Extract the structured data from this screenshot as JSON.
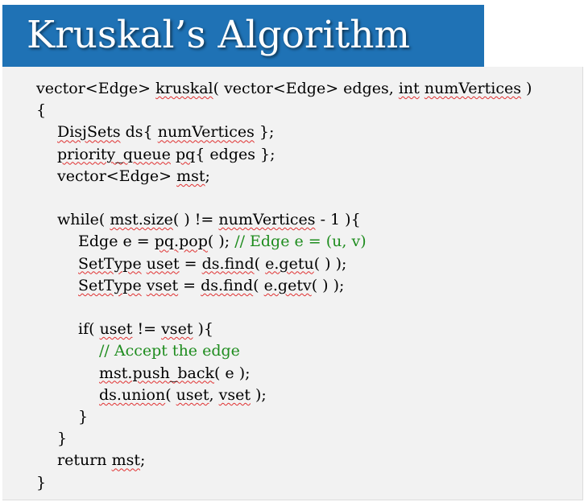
{
  "title": "Kruskal’s Algorithm",
  "colors": {
    "title_bg": "#1f72b5",
    "title_text": "#ffffff",
    "code_bg": "#f2f2f2",
    "comment": "#1e8c1e",
    "spellcheck_underline": "#e03030"
  },
  "code": [
    {
      "indent": 0,
      "segments": [
        {
          "text": "vector<Edge> ",
          "style": "plain"
        },
        {
          "text": "kruskal",
          "style": "squiggle"
        },
        {
          "text": "( vector<Edge> edges, ",
          "style": "plain"
        },
        {
          "text": "int",
          "style": "squiggle"
        },
        {
          "text": " ",
          "style": "plain"
        },
        {
          "text": "numVertices",
          "style": "squiggle"
        },
        {
          "text": " )",
          "style": "plain"
        }
      ]
    },
    {
      "indent": 0,
      "segments": [
        {
          "text": "{",
          "style": "plain"
        }
      ]
    },
    {
      "indent": 1,
      "segments": [
        {
          "text": "DisjSets",
          "style": "squiggle"
        },
        {
          "text": " ds{ ",
          "style": "plain"
        },
        {
          "text": "numVertices",
          "style": "squiggle"
        },
        {
          "text": " };",
          "style": "plain"
        }
      ]
    },
    {
      "indent": 1,
      "segments": [
        {
          "text": "priority_queue",
          "style": "squiggle"
        },
        {
          "text": " ",
          "style": "plain"
        },
        {
          "text": "pq",
          "style": "squiggle"
        },
        {
          "text": "{ edges };",
          "style": "plain"
        }
      ]
    },
    {
      "indent": 1,
      "segments": [
        {
          "text": "vector<Edge> ",
          "style": "plain"
        },
        {
          "text": "mst",
          "style": "squiggle"
        },
        {
          "text": ";",
          "style": "plain"
        }
      ]
    },
    {
      "indent": 0,
      "segments": []
    },
    {
      "indent": 1,
      "segments": [
        {
          "text": "while( ",
          "style": "plain"
        },
        {
          "text": "mst.size",
          "style": "squiggle"
        },
        {
          "text": "( ) != ",
          "style": "plain"
        },
        {
          "text": "numVertices",
          "style": "squiggle"
        },
        {
          "text": " - 1 ){",
          "style": "plain"
        }
      ]
    },
    {
      "indent": 2,
      "segments": [
        {
          "text": "Edge e = ",
          "style": "plain"
        },
        {
          "text": "pq.pop",
          "style": "squiggle"
        },
        {
          "text": "( ); ",
          "style": "plain"
        },
        {
          "text": "// Edge e = (u, v)",
          "style": "comment"
        }
      ]
    },
    {
      "indent": 2,
      "segments": [
        {
          "text": "SetType",
          "style": "squiggle"
        },
        {
          "text": " ",
          "style": "plain"
        },
        {
          "text": "uset",
          "style": "squiggle"
        },
        {
          "text": " = ",
          "style": "plain"
        },
        {
          "text": "ds.find",
          "style": "squiggle"
        },
        {
          "text": "( ",
          "style": "plain"
        },
        {
          "text": "e.getu",
          "style": "squiggle"
        },
        {
          "text": "( ) );",
          "style": "plain"
        }
      ]
    },
    {
      "indent": 2,
      "segments": [
        {
          "text": "SetType",
          "style": "squiggle"
        },
        {
          "text": " ",
          "style": "plain"
        },
        {
          "text": "vset",
          "style": "squiggle"
        },
        {
          "text": " = ",
          "style": "plain"
        },
        {
          "text": "ds.find",
          "style": "squiggle"
        },
        {
          "text": "( ",
          "style": "plain"
        },
        {
          "text": "e.getv",
          "style": "squiggle"
        },
        {
          "text": "( ) );",
          "style": "plain"
        }
      ]
    },
    {
      "indent": 0,
      "segments": []
    },
    {
      "indent": 2,
      "segments": [
        {
          "text": "if( ",
          "style": "plain"
        },
        {
          "text": "uset",
          "style": "squiggle"
        },
        {
          "text": " != ",
          "style": "plain"
        },
        {
          "text": "vset",
          "style": "squiggle"
        },
        {
          "text": " ){",
          "style": "plain"
        }
      ]
    },
    {
      "indent": 3,
      "segments": [
        {
          "text": "// Accept the edge",
          "style": "comment"
        }
      ]
    },
    {
      "indent": 3,
      "segments": [
        {
          "text": "mst.push_back",
          "style": "squiggle"
        },
        {
          "text": "( e );",
          "style": "plain"
        }
      ]
    },
    {
      "indent": 3,
      "segments": [
        {
          "text": "ds.union",
          "style": "squiggle"
        },
        {
          "text": "( ",
          "style": "plain"
        },
        {
          "text": "uset",
          "style": "squiggle"
        },
        {
          "text": ", ",
          "style": "plain"
        },
        {
          "text": "vset",
          "style": "squiggle"
        },
        {
          "text": " );",
          "style": "plain"
        }
      ]
    },
    {
      "indent": 2,
      "segments": [
        {
          "text": "}",
          "style": "plain"
        }
      ]
    },
    {
      "indent": 1,
      "segments": [
        {
          "text": "}",
          "style": "plain"
        }
      ]
    },
    {
      "indent": 1,
      "segments": [
        {
          "text": "return ",
          "style": "plain"
        },
        {
          "text": "mst",
          "style": "squiggle"
        },
        {
          "text": ";",
          "style": "plain"
        }
      ]
    },
    {
      "indent": 0,
      "segments": [
        {
          "text": "}",
          "style": "plain"
        }
      ]
    }
  ]
}
